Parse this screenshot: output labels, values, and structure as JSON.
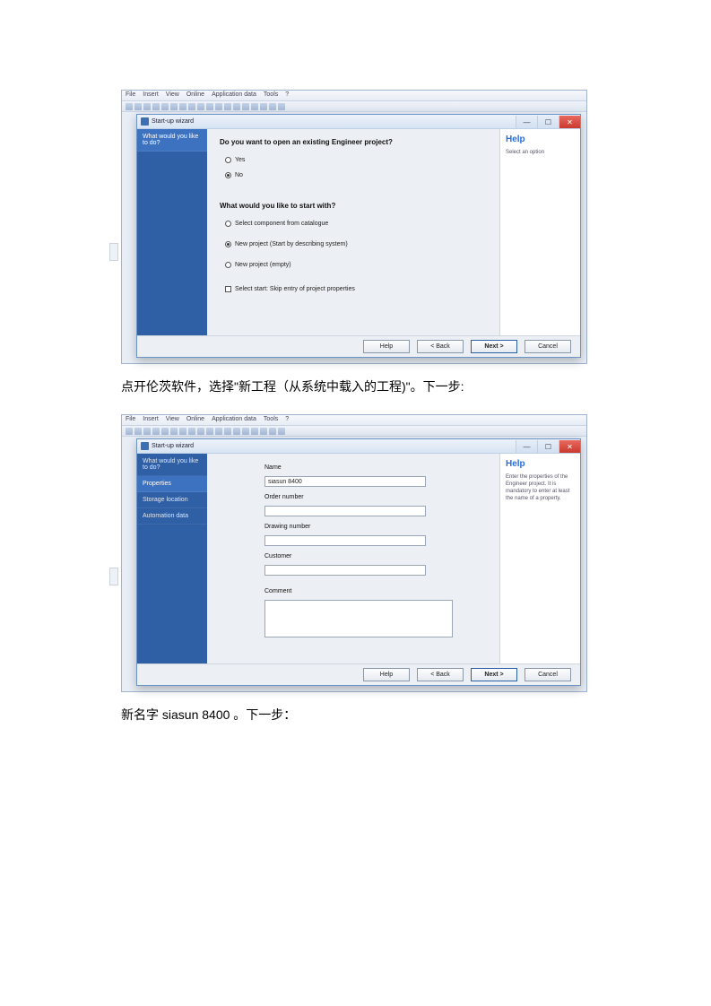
{
  "screenshot1": {
    "menubar": [
      "File",
      "Insert",
      "View",
      "Online",
      "Application data",
      "Tools",
      "?"
    ],
    "dialog_title": "Start-up wizard",
    "sidebar": {
      "items": [
        {
          "label": "What would you like to do?",
          "active": true
        }
      ]
    },
    "help": {
      "title": "Help",
      "text": "Select an option"
    },
    "q1": {
      "title": "Do you want to open an existing Engineer project?",
      "options": [
        {
          "label": "Yes",
          "selected": false
        },
        {
          "label": "No",
          "selected": true
        }
      ]
    },
    "q2": {
      "title": "What would you like to start with?",
      "options": [
        {
          "label": "Select component from catalogue",
          "selected": false
        },
        {
          "label": "New project (Start by describing system)",
          "selected": true
        },
        {
          "label": "New project (empty)",
          "selected": false
        }
      ]
    },
    "checkbox": {
      "label": "Select start: Skip entry of project properties",
      "checked": false
    },
    "buttons": {
      "help": "Help",
      "back": "< Back",
      "next": "Next >",
      "cancel": "Cancel"
    },
    "win": {
      "min": "—",
      "max": "☐",
      "close": "✕"
    }
  },
  "caption1": "点开伦茨软件，选择\"新工程（从系统中载入的工程)\"。下一步:",
  "screenshot2": {
    "menubar": [
      "File",
      "Insert",
      "View",
      "Online",
      "Application data",
      "Tools",
      "?"
    ],
    "dialog_title": "Start-up wizard",
    "sidebar": {
      "items": [
        {
          "label": "What would you like to do?",
          "active": false
        },
        {
          "label": "Properties",
          "active": true
        },
        {
          "label": "Storage location",
          "active": false
        },
        {
          "label": "Automation data",
          "active": false
        }
      ]
    },
    "help": {
      "title": "Help",
      "text": "Enter the properties of the Engineer project. It is mandatory to enter at least the name of a property."
    },
    "fields": {
      "name_label": "Name",
      "name_value": "siasun 8400",
      "order_label": "Order number",
      "drawing_label": "Drawing number",
      "customer_label": "Customer",
      "comment_label": "Comment"
    },
    "buttons": {
      "help": "Help",
      "back": "< Back",
      "next": "Next >",
      "cancel": "Cancel"
    },
    "win": {
      "min": "—",
      "max": "☐",
      "close": "✕"
    }
  },
  "caption2": "新名字 siasun 8400 。下一步："
}
